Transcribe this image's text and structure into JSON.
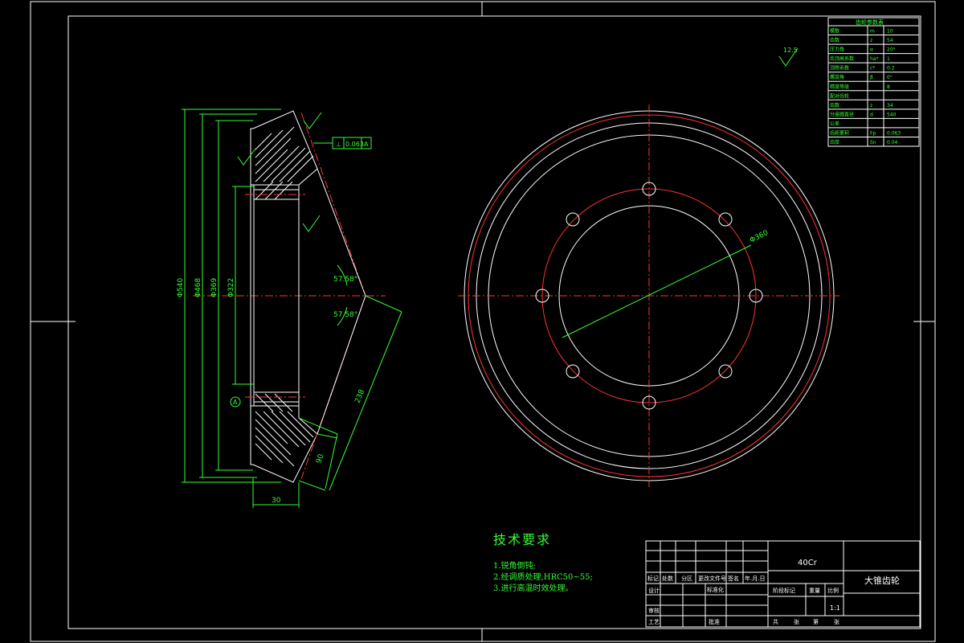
{
  "technical_requirements": {
    "title": "技术要求",
    "items": [
      "1.锐角倒钝;",
      "2.经调质处理,HRC50~55;",
      "3.进行高温时效处理。"
    ]
  },
  "title_block": {
    "material": "40Cr",
    "part_name": "大锥齿轮",
    "scale": "1:1",
    "col_labels": [
      "标记",
      "处数",
      "分区",
      "更改文件号",
      "签名",
      "年.月.日"
    ],
    "rows": [
      "设计",
      "审核",
      "工艺"
    ],
    "std_label": "标准化",
    "approve_label": "批准",
    "stage_label": "阶段标记",
    "weight_label": "重量",
    "ratio_label": "比例",
    "sheet": [
      "共",
      "张",
      "第",
      "张"
    ]
  },
  "parameter_table": {
    "title": "齿轮参数表",
    "rows": [
      [
        "模数",
        "m",
        "10"
      ],
      [
        "齿数",
        "z",
        "54"
      ],
      [
        "压力角",
        "α",
        "20°"
      ],
      [
        "齿顶高系数",
        "ha*",
        "1"
      ],
      [
        "顶隙系数",
        "c*",
        "0.2"
      ],
      [
        "螺旋角",
        "β",
        "0°"
      ],
      [
        "精度等级",
        "",
        "8"
      ],
      [
        "配对齿轮",
        "",
        ""
      ],
      [
        "齿数",
        "z",
        "34"
      ],
      [
        "分度圆直径",
        "d",
        "540"
      ],
      [
        "公差",
        "",
        ""
      ],
      [
        "齿距累积",
        "Fp",
        "0.063"
      ],
      [
        "齿厚",
        "Sn",
        "0.04"
      ]
    ]
  },
  "dimensions": {
    "phi540": "Φ540",
    "phi468": "Φ468",
    "phi369": "Φ369",
    "phi322": "Φ322",
    "w30": "30",
    "len90": "90",
    "len238": "238",
    "ang1": "57.58°",
    "ang2": "57.58°",
    "d360": "Φ360",
    "roughness": "12.5",
    "tol": "0.063",
    "datum": "A"
  }
}
